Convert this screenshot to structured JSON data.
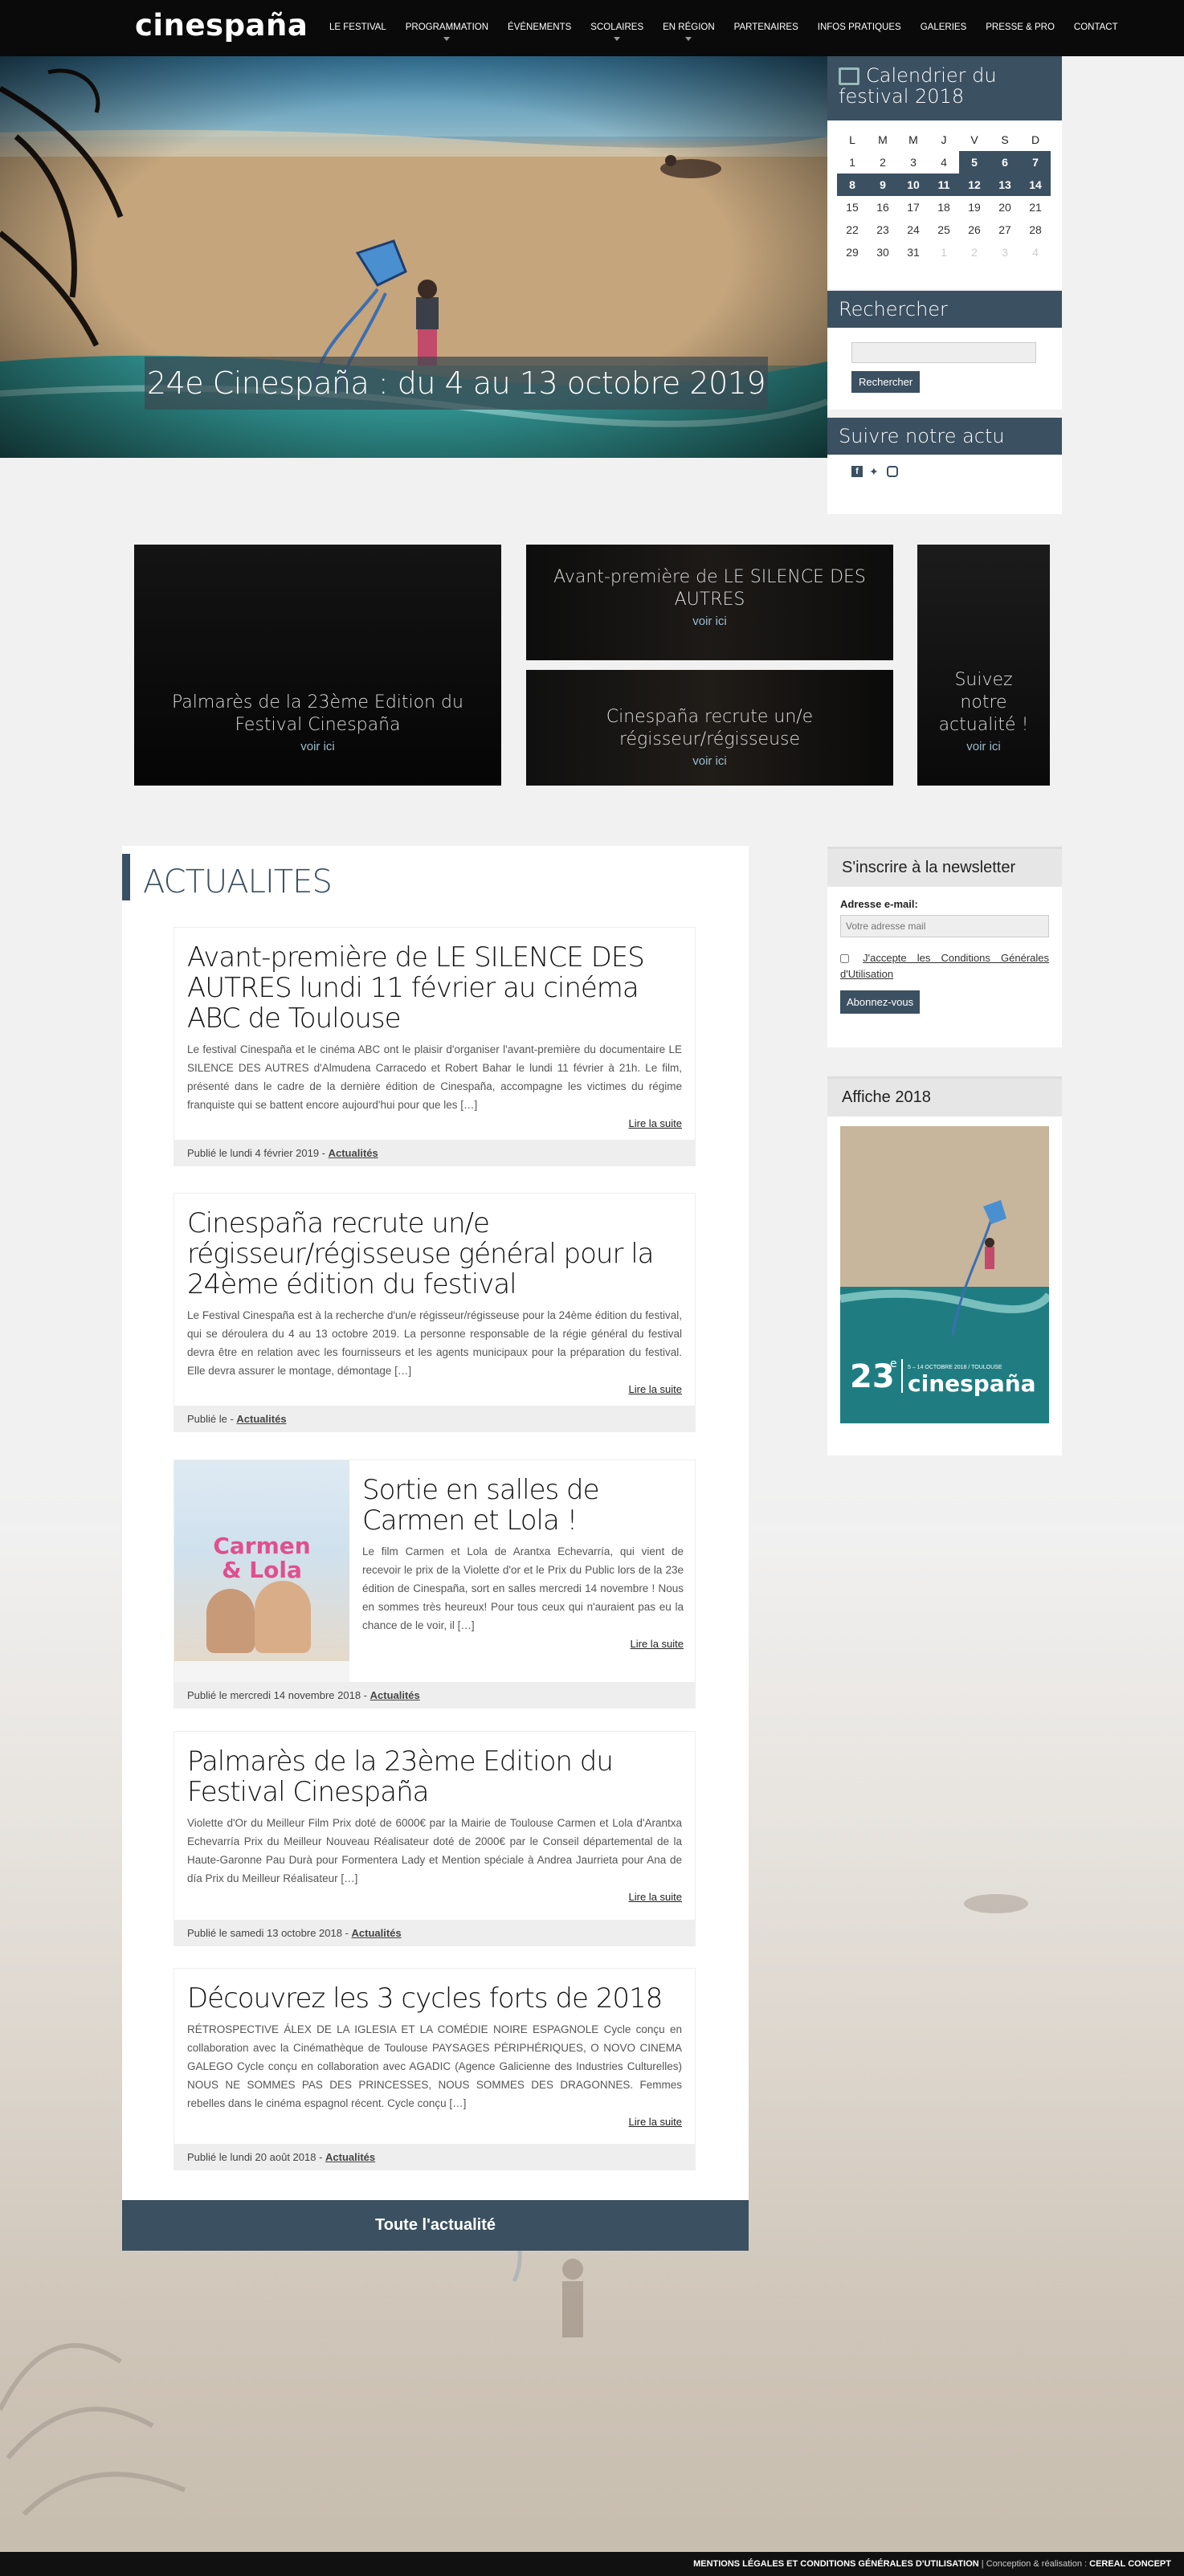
{
  "site": {
    "logo": "cinespaña"
  },
  "nav": {
    "items": [
      {
        "label": "LE FESTIVAL",
        "chevron": false
      },
      {
        "label": "PROGRAMMATION",
        "chevron": true
      },
      {
        "label": "ÉVÉNEMENTS",
        "chevron": false
      },
      {
        "label": "SCOLAIRES",
        "chevron": true
      },
      {
        "label": "EN RÉGION",
        "chevron": true
      },
      {
        "label": "PARTENAIRES",
        "chevron": false
      },
      {
        "label": "INFOS PRATIQUES",
        "chevron": false
      },
      {
        "label": "GALERIES",
        "chevron": false
      },
      {
        "label": "PRESSE & PRO",
        "chevron": false
      },
      {
        "label": "CONTACT",
        "chevron": false
      }
    ]
  },
  "hero": {
    "title": "24e Cinespaña : du 4 au 13 octobre 2019"
  },
  "calendar": {
    "title": "Calendrier du festival 2018",
    "days": [
      "L",
      "M",
      "M",
      "J",
      "V",
      "S",
      "D"
    ],
    "weeks": [
      [
        "1",
        "2",
        "3",
        "4",
        "5",
        "6",
        "7"
      ],
      [
        "8",
        "9",
        "10",
        "11",
        "12",
        "13",
        "14"
      ],
      [
        "15",
        "16",
        "17",
        "18",
        "19",
        "20",
        "21"
      ],
      [
        "22",
        "23",
        "24",
        "25",
        "26",
        "27",
        "28"
      ],
      [
        "29",
        "30",
        "31",
        "1",
        "2",
        "3",
        "4"
      ]
    ]
  },
  "search": {
    "title": "Rechercher",
    "button": "Rechercher"
  },
  "social": {
    "title": "Suivre notre actu",
    "icons": [
      "facebook-icon",
      "twitter-icon",
      "instagram-icon"
    ]
  },
  "tiles": [
    {
      "title": "Palmarès de la 23ème Edition du Festival Cinespaña",
      "link": "voir ici"
    },
    {
      "title": "Avant-première de LE SILENCE DES AUTRES",
      "link": "voir ici"
    },
    {
      "title": "Cinespaña recrute un/e régisseur/régisseuse",
      "link": "voir ici"
    },
    {
      "title": "Suivez notre actualité !",
      "link": "voir ici"
    }
  ],
  "news": {
    "heading": "ACTUALITES",
    "read_more": "Lire la suite",
    "all_label": "Toute l'actualité",
    "articles": [
      {
        "title": "Avant-première de LE SILENCE DES AUTRES lundi 11 février au cinéma ABC de Toulouse",
        "excerpt": "Le festival Cinespaña et le cinéma ABC ont le plaisir d'organiser l'avant-première du documentaire LE SILENCE DES AUTRES d'Almudena Carracedo et Robert Bahar le lundi 11 février à 21h. Le film, présenté dans le cadre de la dernière édition de Cinespaña, accompagne les victimes du régime franquiste qui se battent encore aujourd'hui pour que les […]",
        "meta": "Publié le lundi 4 février 2019 - ",
        "category": "Actualités"
      },
      {
        "title": "Cinespaña recrute un/e régisseur/régisseuse général pour la 24ème édition du festival",
        "excerpt": "Le Festival Cinespaña est à la recherche d'un/e régisseur/régisseuse pour la 24ème édition du festival, qui se déroulera du 4 au 13 octobre 2019. La personne responsable de la régie général du festival devra être en relation avec les fournisseurs et les agents municipaux pour la préparation du festival. Elle devra assurer le montage, démontage […]",
        "meta": "Publié le - ",
        "category": "Actualités"
      },
      {
        "title": "Sortie en salles de Carmen et Lola !",
        "excerpt": "Le film Carmen et Lola de Arantxa Echevarría, qui vient de recevoir le prix de la Violette d'or et le Prix du Public lors de la 23e édition de Cinespaña, sort en salles mercredi 14 novembre ! Nous en sommes très heureux! Pour tous ceux qui n'auraient pas eu la chance de le voir, il […]",
        "meta": "Publié le mercredi 14 novembre 2018 - ",
        "category": "Actualités",
        "poster_title_1": "Carmen",
        "poster_title_2": "& Lola"
      },
      {
        "title": "Palmarès de la 23ème Edition du Festival Cinespaña",
        "excerpt": "Violette d'Or du Meilleur Film Prix doté de 6000€ par la Mairie de Toulouse Carmen et Lola d'Arantxa Echevarría   Prix du Meilleur Nouveau Réalisateur doté de 2000€ par le Conseil départemental de la Haute-Garonne Pau Durà pour Formentera Lady et Mention spéciale à Andrea Jaurrieta pour Ana de día   Prix du Meilleur Réalisateur […]",
        "meta": "Publié le samedi 13 octobre 2018 - ",
        "category": "Actualités"
      },
      {
        "title": "Découvrez les 3 cycles forts de 2018",
        "excerpt": "RÉTROSPECTIVE ÁLEX DE LA IGLESIA ET LA COMÉDIE NOIRE ESPAGNOLE Cycle conçu en collaboration avec la Cinémathèque de Toulouse PAYSAGES PÉRIPHÉRIQUES, O NOVO CINEMA GALEGO Cycle conçu en collaboration avec AGADIC (Agence Galicienne des Industries Culturelles) NOUS NE SOMMES PAS DES PRINCESSES, NOUS SOMMES DES DRAGONNES. Femmes rebelles dans le cinéma espagnol récent. Cycle conçu […]",
        "meta": "Publié le lundi 20 août 2018 - ",
        "category": "Actualités"
      }
    ]
  },
  "newsletter": {
    "title": "S'inscrire à la newsletter",
    "label": "Adresse e-mail:",
    "placeholder": "Votre adresse mail",
    "cgu": "J'accepte les Conditions Générales d'Utilisation",
    "button": "Abonnez-vous"
  },
  "poster": {
    "title": "Affiche 2018",
    "number": "23",
    "sup": "e",
    "brand": "cinespaña",
    "dates": "5 – 14 OCTOBRE 2018 / TOULOUSE"
  },
  "footer": {
    "legal": "MENTIONS LÉGALES ET CONDITIONS GÉNÉRALES D'UTILISATION",
    "credit": "Conception & réalisation : ",
    "agency": "CEREAL CONCEPT"
  },
  "colors": {
    "accent": "#3b5061",
    "topbar": "#0a0a0a",
    "page": "#f1f1f1"
  }
}
